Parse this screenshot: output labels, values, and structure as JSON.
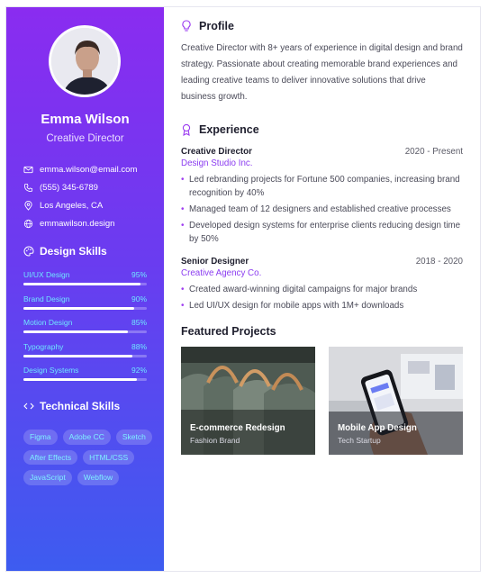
{
  "profile": {
    "name": "Emma Wilson",
    "title": "Creative Director"
  },
  "contact": [
    {
      "icon": "mail-icon",
      "text": "emma.wilson@email.com"
    },
    {
      "icon": "phone-icon",
      "text": "(555) 345-6789"
    },
    {
      "icon": "location-pin-icon",
      "text": "Los Angeles, CA"
    },
    {
      "icon": "globe-icon",
      "text": "emmawilson.design"
    }
  ],
  "design_skills": {
    "heading": "Design Skills",
    "items": [
      {
        "label": "UI/UX Design",
        "percent_label": "95%",
        "level": 0.95
      },
      {
        "label": "Brand Design",
        "percent_label": "90%",
        "level": 0.9
      },
      {
        "label": "Motion Design",
        "percent_label": "85%",
        "level": 0.85
      },
      {
        "label": "Typography",
        "percent_label": "88%",
        "level": 0.88
      },
      {
        "label": "Design Systems",
        "percent_label": "92%",
        "level": 0.92
      }
    ]
  },
  "technical_skills": {
    "heading": "Technical Skills",
    "tags": [
      "Figma",
      "Adobe CC",
      "Sketch",
      "After Effects",
      "HTML/CSS",
      "JavaScript",
      "Webflow"
    ]
  },
  "profile_section": {
    "heading": "Profile",
    "text": "Creative Director with 8+ years of experience in digital design and brand strategy. Passionate about creating memorable brand experiences and leading creative teams to deliver innovative solutions that drive business growth."
  },
  "experience": {
    "heading": "Experience",
    "jobs": [
      {
        "title": "Creative Director",
        "dates": "2020 - Present",
        "company": "Design Studio Inc.",
        "bullets": [
          "Led rebranding projects for Fortune 500 companies, increasing brand recognition by 40%",
          "Managed team of 12 designers and established creative processes",
          "Developed design systems for enterprise clients reducing design time by 50%"
        ]
      },
      {
        "title": "Senior Designer",
        "dates": "2018 - 2020",
        "company": "Creative Agency Co.",
        "bullets": [
          "Created award-winning digital campaigns for major brands",
          "Led UI/UX design for mobile apps with 1M+ downloads"
        ]
      }
    ]
  },
  "projects": {
    "heading": "Featured Projects",
    "items": [
      {
        "title": "E-commerce Redesign",
        "subtitle": "Fashion Brand"
      },
      {
        "title": "Mobile App Design",
        "subtitle": "Tech Startup"
      }
    ]
  },
  "colors": {
    "sidebar_top": "#8a2cf0",
    "sidebar_bottom": "#3d5cf0",
    "accent_purple": "#8b3cf0",
    "skill_label": "#6fe6ff"
  }
}
